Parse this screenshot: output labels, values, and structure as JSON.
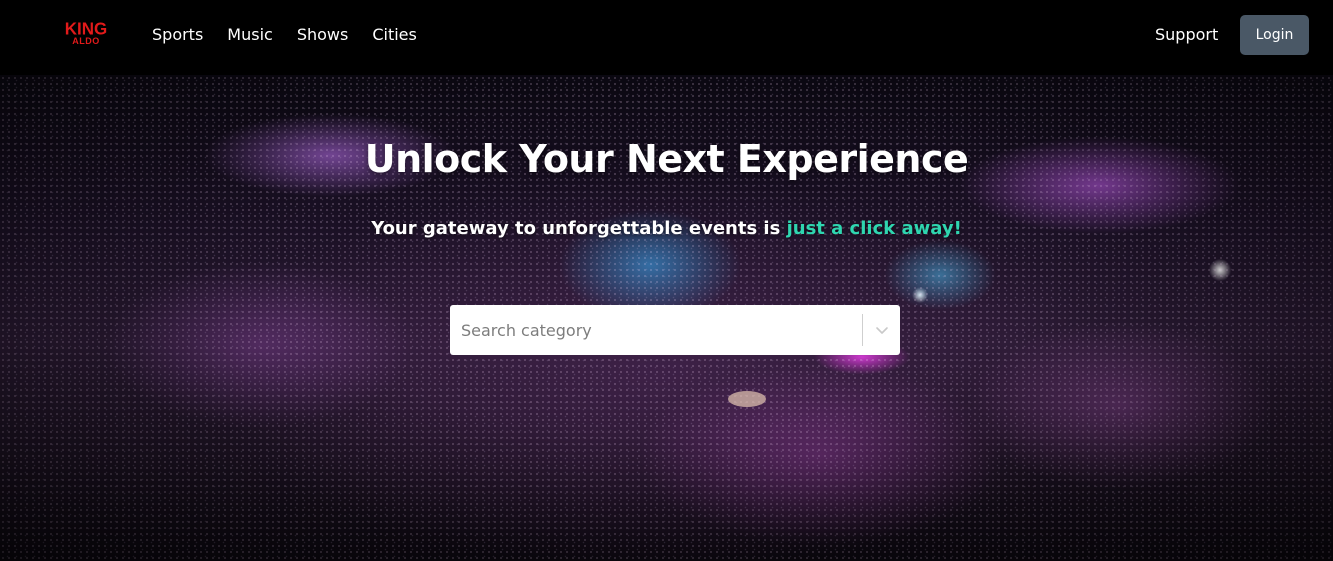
{
  "brand": {
    "logo_top": "KING",
    "logo_bottom": "ALDO",
    "color": "#e11a1a"
  },
  "nav": {
    "links": [
      {
        "label": "Sports"
      },
      {
        "label": "Music"
      },
      {
        "label": "Shows"
      },
      {
        "label": "Cities"
      }
    ],
    "support_label": "Support",
    "login_label": "Login"
  },
  "hero": {
    "title": "Unlock Your Next Experience",
    "subtitle_plain": "Your gateway to unforgettable events is ",
    "subtitle_accent": "just a click away!",
    "accent_color": "#2fd6b0",
    "background": "concert arena crowd photo"
  },
  "search": {
    "placeholder": "Search category",
    "value": "",
    "dropdown_icon": "chevron-down-icon"
  }
}
